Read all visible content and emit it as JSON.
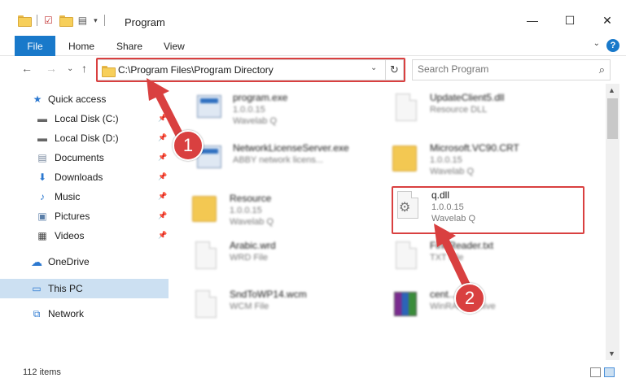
{
  "window": {
    "title": "Program"
  },
  "ribbon": {
    "tabs": [
      "File",
      "Home",
      "Share",
      "View"
    ]
  },
  "address": {
    "path": "C:\\Program Files\\Program Directory"
  },
  "search": {
    "placeholder": "Search Program"
  },
  "nav": {
    "items": [
      {
        "label": "Quick access",
        "icon": "star-icon",
        "pinned": false
      },
      {
        "label": "Local Disk (C:)",
        "icon": "drive-icon",
        "pinned": true
      },
      {
        "label": "Local Disk (D:)",
        "icon": "drive-icon",
        "pinned": true
      },
      {
        "label": "Documents",
        "icon": "documents-icon",
        "pinned": true
      },
      {
        "label": "Downloads",
        "icon": "download-icon",
        "pinned": true
      },
      {
        "label": "Music",
        "icon": "music-icon",
        "pinned": true
      },
      {
        "label": "Pictures",
        "icon": "pictures-icon",
        "pinned": true
      },
      {
        "label": "Videos",
        "icon": "videos-icon",
        "pinned": true
      },
      {
        "label": "OneDrive",
        "icon": "cloud-icon",
        "pinned": false
      },
      {
        "label": "This PC",
        "icon": "computer-icon",
        "pinned": false,
        "selected": true
      },
      {
        "label": "Network",
        "icon": "network-icon",
        "pinned": false
      }
    ]
  },
  "files": [
    {
      "name": "program.exe",
      "line1": "1.0.0.15",
      "line2": "Wavelab Q",
      "icon": "exe-icon"
    },
    {
      "name": "UpdateClient5.dll",
      "line1": "Resource DLL",
      "line2": "",
      "icon": "dll-icon"
    },
    {
      "name": "NetworkLicenseServer.exe",
      "line1": "ABBY network licens...",
      "line2": "",
      "icon": "exe-icon"
    },
    {
      "name": "Microsoft.VC90.CRT",
      "line1": "1.0.0.15",
      "line2": "Wavelab Q",
      "icon": "folder-icon"
    },
    {
      "name": "Resource",
      "line1": "1.0.0.15",
      "line2": "Wavelab Q",
      "icon": "folder-icon"
    },
    {
      "name": "q.dll",
      "line1": "1.0.0.15",
      "line2": "Wavelab Q",
      "icon": "dll-gear-icon"
    },
    {
      "name": "Arabic.wrd",
      "line1": "WRD File",
      "line2": "",
      "icon": "file-icon"
    },
    {
      "name": "FineReader.txt",
      "line1": "TXT File",
      "line2": "",
      "icon": "file-icon"
    },
    {
      "name": "SndToWP14.wcm",
      "line1": "WCM File",
      "line2": "",
      "icon": "file-icon"
    },
    {
      "name": "cent...s.cab",
      "line1": "WinRAR archive",
      "line2": "",
      "icon": "rar-icon"
    }
  ],
  "status": {
    "count": "112 items"
  },
  "markers": {
    "one": "1",
    "two": "2"
  },
  "colors": {
    "accent": "#1979ca",
    "highlight": "#d94040",
    "selection": "#cce0f2"
  }
}
